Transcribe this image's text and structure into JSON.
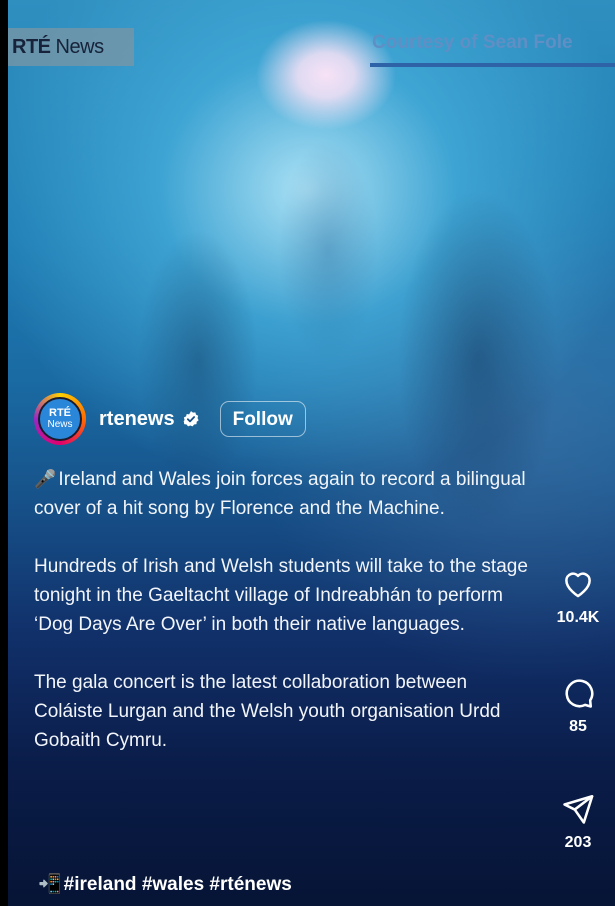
{
  "watermark": {
    "brand_bold": "RTÉ",
    "brand_rest": " News"
  },
  "video_credit": "Courtesy of Sean Fole",
  "author": {
    "avatar_line1": "RTÉ",
    "avatar_line2": "News",
    "username": "rtenews",
    "follow_label": "Follow"
  },
  "caption": {
    "paragraph1_emoji": "🎤",
    "paragraph1": "Ireland and Wales join forces again to record a bilingual cover of a hit song by Florence and the Machine.",
    "paragraph2": "Hundreds of Irish and Welsh students will take to the stage tonight in the Gaeltacht village of Indreabhán to perform ‘Dog Days Are Over’ in both their native languages.",
    "paragraph3": "The gala concert is the latest collaboration between Coláiste Lurgan and the Welsh youth organisation Urdd Gobaith Cymru.",
    "hashtags_emoji": "📲",
    "hashtags": "#ireland #wales #rténews"
  },
  "actions": {
    "like_count": "10.4K",
    "comment_count": "85",
    "share_count": "203"
  },
  "icons": [
    "heart-icon",
    "comment-icon",
    "share-icon",
    "verified-icon"
  ],
  "colors": {
    "verified_badge": "#ffffff",
    "follow_border": "#ffffff"
  }
}
